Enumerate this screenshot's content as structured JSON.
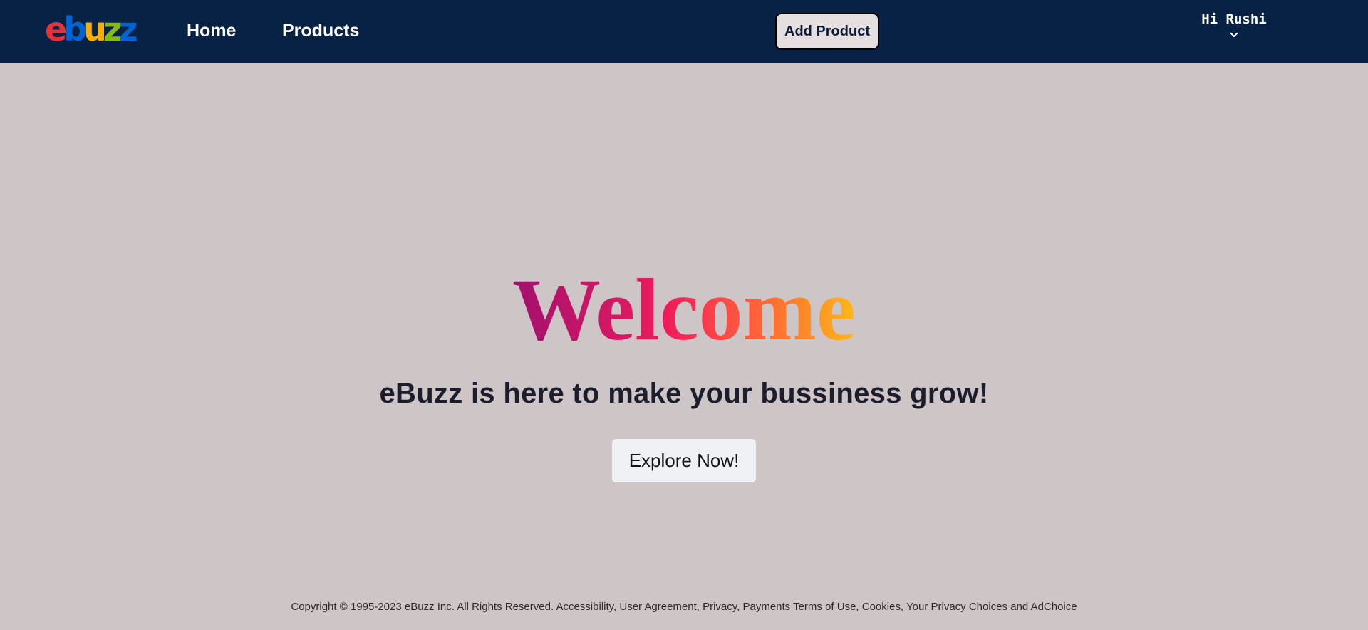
{
  "navbar": {
    "logo": {
      "letters": [
        {
          "char": "e",
          "color": "#e53238"
        },
        {
          "char": "b",
          "color": "#0064d2"
        },
        {
          "char": "u",
          "color": "#f5af02"
        },
        {
          "char": "z",
          "color": "#86b817"
        },
        {
          "char": "z",
          "color": "#0064d2"
        }
      ]
    },
    "links": {
      "home": "Home",
      "products": "Products"
    },
    "add_product_label": "Add Product",
    "user": {
      "greeting": "Hi Rushi",
      "icon": "chevron-down-icon"
    },
    "background": "#082245"
  },
  "hero": {
    "title": "Welcome",
    "subtitle": "eBuzz is here to make your bussiness grow!",
    "cta_label": "Explore Now!",
    "gradient": [
      "#a0106e",
      "#ee1c5b",
      "#ff7a2c",
      "#ffb81a"
    ]
  },
  "footer": {
    "text": "Copyright © 1995-2023 eBuzz Inc. All Rights Reserved. Accessibility, User Agreement, Privacy, Payments Terms of Use, Cookies, Your Privacy Choices and AdChoice"
  },
  "colors": {
    "page_background": "#cec5c6"
  }
}
